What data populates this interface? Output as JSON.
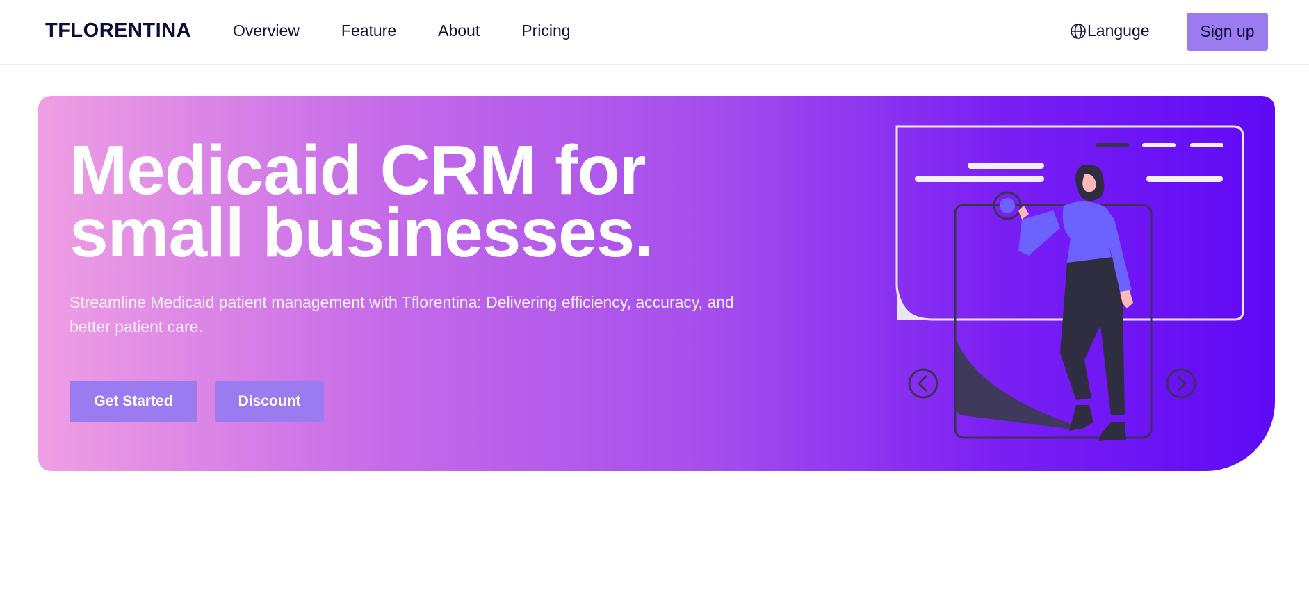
{
  "brand": {
    "name": "TFLORENTINA"
  },
  "nav": {
    "links": [
      "Overview",
      "Feature",
      "About",
      "Pricing"
    ],
    "language_label": "Langugе",
    "language_icon": "globe-icon",
    "signup_label": "Sign up"
  },
  "hero": {
    "title": "Medicaid CRM for small businesses.",
    "subtitle": "Streamline Medicaid patient management with Tflorentina: Delivering efficiency, accuracy, and better patient care.",
    "primary_button": "Get Started",
    "secondary_button": "Discount",
    "carousel_prev_icon": "chevron-left-icon",
    "carousel_next_icon": "chevron-right-icon"
  },
  "colors": {
    "accent": "#9a7cf0",
    "gradient_start": "#ef9fe3",
    "gradient_end": "#5f0af6",
    "text_dark": "#0d0f3a"
  }
}
